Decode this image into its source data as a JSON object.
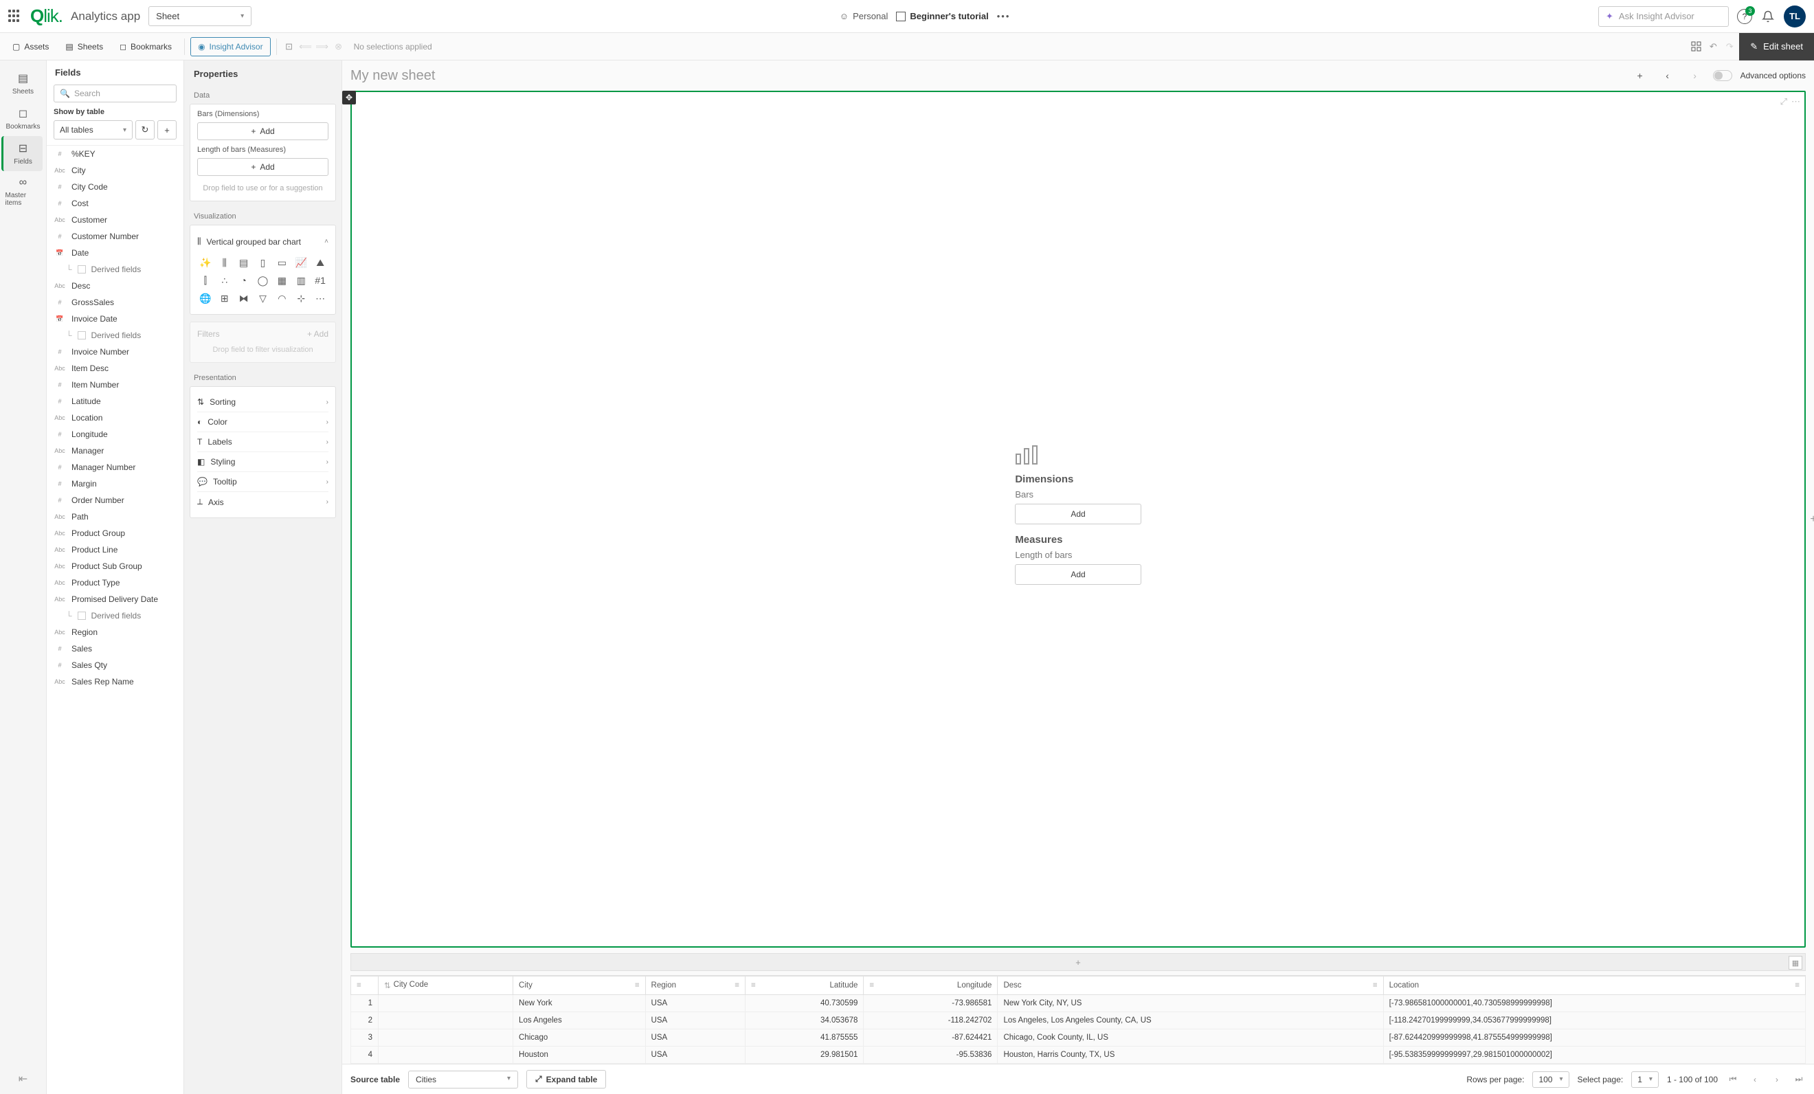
{
  "topbar": {
    "logo_text": "Qlik",
    "app_name": "Analytics app",
    "sheet_dropdown": "Sheet",
    "personal": "Personal",
    "tutorial": "Beginner's tutorial",
    "ask_placeholder": "Ask Insight Advisor",
    "badge_count": "3",
    "avatar_initials": "TL"
  },
  "toolbar": {
    "assets": "Assets",
    "sheets": "Sheets",
    "bookmarks": "Bookmarks",
    "insight": "Insight Advisor",
    "no_selections": "No selections applied",
    "edit_sheet": "Edit sheet"
  },
  "rail": {
    "sheets": "Sheets",
    "bookmarks": "Bookmarks",
    "fields": "Fields",
    "master": "Master items"
  },
  "fields_panel": {
    "title": "Fields",
    "search_placeholder": "Search",
    "show_by": "Show by table",
    "all_tables": "All tables",
    "items": [
      {
        "type": "#",
        "name": "%KEY"
      },
      {
        "type": "Abc",
        "name": "City"
      },
      {
        "type": "#",
        "name": "City Code"
      },
      {
        "type": "#",
        "name": "Cost"
      },
      {
        "type": "Abc",
        "name": "Customer"
      },
      {
        "type": "#",
        "name": "Customer Number"
      },
      {
        "type": "cal",
        "name": "Date"
      },
      {
        "type": "derived",
        "name": "Derived fields"
      },
      {
        "type": "Abc",
        "name": "Desc"
      },
      {
        "type": "#",
        "name": "GrossSales"
      },
      {
        "type": "cal",
        "name": "Invoice Date"
      },
      {
        "type": "derived",
        "name": "Derived fields"
      },
      {
        "type": "#",
        "name": "Invoice Number"
      },
      {
        "type": "Abc",
        "name": "Item Desc"
      },
      {
        "type": "#",
        "name": "Item Number"
      },
      {
        "type": "#",
        "name": "Latitude"
      },
      {
        "type": "Abc",
        "name": "Location"
      },
      {
        "type": "#",
        "name": "Longitude"
      },
      {
        "type": "Abc",
        "name": "Manager"
      },
      {
        "type": "#",
        "name": "Manager Number"
      },
      {
        "type": "#",
        "name": "Margin"
      },
      {
        "type": "#",
        "name": "Order Number"
      },
      {
        "type": "Abc",
        "name": "Path"
      },
      {
        "type": "Abc",
        "name": "Product Group"
      },
      {
        "type": "Abc",
        "name": "Product Line"
      },
      {
        "type": "Abc",
        "name": "Product Sub Group"
      },
      {
        "type": "Abc",
        "name": "Product Type"
      },
      {
        "type": "Abc",
        "name": "Promised Delivery Date"
      },
      {
        "type": "derived",
        "name": "Derived fields"
      },
      {
        "type": "Abc",
        "name": "Region"
      },
      {
        "type": "#",
        "name": "Sales"
      },
      {
        "type": "#",
        "name": "Sales Qty"
      },
      {
        "type": "Abc",
        "name": "Sales Rep Name"
      }
    ]
  },
  "props": {
    "title": "Properties",
    "data_label": "Data",
    "bars_dim": "Bars (Dimensions)",
    "len_meas": "Length of bars (Measures)",
    "add": "Add",
    "drop_suggest": "Drop field to use or for a suggestion",
    "viz_label": "Visualization",
    "viz_name": "Vertical grouped bar chart",
    "filters": "Filters",
    "filters_add": "+ Add",
    "drop_filter": "Drop field to filter visualization",
    "presentation": "Presentation",
    "pres_items": [
      "Sorting",
      "Color",
      "Labels",
      "Styling",
      "Tooltip",
      "Axis"
    ]
  },
  "canvas": {
    "sheet_title": "My new sheet",
    "advanced": "Advanced options",
    "dimensions": "Dimensions",
    "bars": "Bars",
    "measures": "Measures",
    "length_bars": "Length of bars",
    "add": "Add"
  },
  "table": {
    "columns": [
      "",
      "City Code",
      "City",
      "Region",
      "Latitude",
      "Longitude",
      "Desc",
      "Location"
    ],
    "rows": [
      {
        "idx": "1",
        "code": "",
        "city": "New York",
        "region": "USA",
        "lat": "40.730599",
        "lon": "-73.986581",
        "desc": "New York City, NY, US",
        "loc": "[-73.986581000000001,40.730598999999998]"
      },
      {
        "idx": "2",
        "code": "",
        "city": "Los Angeles",
        "region": "USA",
        "lat": "34.053678",
        "lon": "-118.242702",
        "desc": "Los Angeles, Los Angeles County, CA, US",
        "loc": "[-118.24270199999999,34.053677999999998]"
      },
      {
        "idx": "3",
        "code": "",
        "city": "Chicago",
        "region": "USA",
        "lat": "41.875555",
        "lon": "-87.624421",
        "desc": "Chicago, Cook County, IL, US",
        "loc": "[-87.624420999999998,41.875554999999998]"
      },
      {
        "idx": "4",
        "code": "",
        "city": "Houston",
        "region": "USA",
        "lat": "29.981501",
        "lon": "-95.53836",
        "desc": "Houston, Harris County, TX, US",
        "loc": "[-95.538359999999997,29.981501000000002]"
      }
    ],
    "source_label": "Source table",
    "source_value": "Cities",
    "expand": "Expand table",
    "rows_per_page": "Rows per page:",
    "rpp_value": "100",
    "select_page": "Select page:",
    "sp_value": "1",
    "range": "1 - 100 of 100"
  }
}
